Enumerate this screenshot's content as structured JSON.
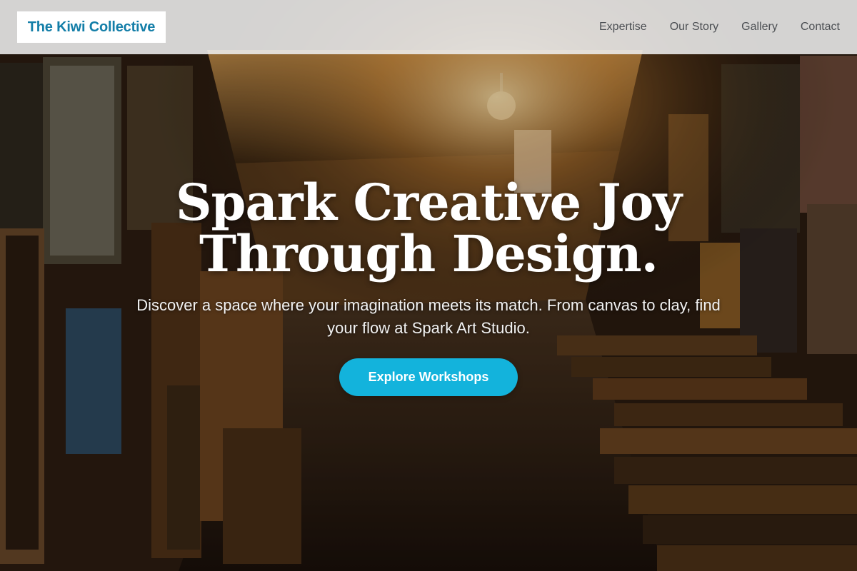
{
  "brand": {
    "name": "The Kiwi Collective"
  },
  "nav": {
    "items": [
      "Expertise",
      "Our Story",
      "Gallery",
      "Contact"
    ]
  },
  "hero": {
    "headline": "Spark Creative Joy Through Design.",
    "subtext": "Discover a space where your imagination meets its match. From canvas to clay, find your flow at Spark Art Studio.",
    "cta_label": "Explore Workshops",
    "background_image": "art-gallery-interior-photo"
  },
  "colors": {
    "brand_text": "#137ea8",
    "cta_background": "#13b3dc",
    "nav_background": "#eeeeee",
    "nav_link": "#4c4f53"
  }
}
